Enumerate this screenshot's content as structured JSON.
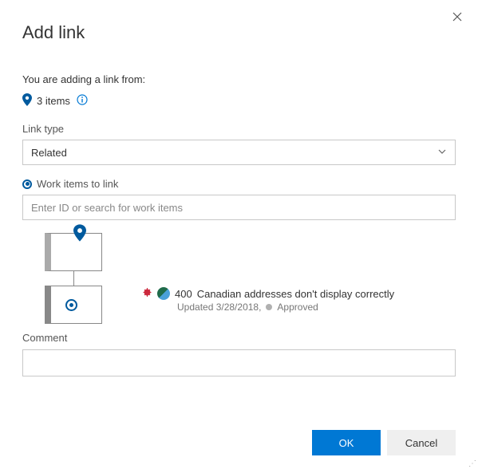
{
  "title": "Add link",
  "intro": "You are adding a link from:",
  "items_count_text": "3 items",
  "link_type": {
    "label": "Link type",
    "value": "Related"
  },
  "work_items": {
    "label": "Work items to link",
    "placeholder": "Enter ID or search for work items",
    "value": ""
  },
  "linked_item": {
    "id": "400",
    "title": "Canadian addresses don't display correctly",
    "updated_text": "Updated 3/28/2018,",
    "state": "Approved"
  },
  "comment": {
    "label": "Comment",
    "value": ""
  },
  "buttons": {
    "ok": "OK",
    "cancel": "Cancel"
  }
}
